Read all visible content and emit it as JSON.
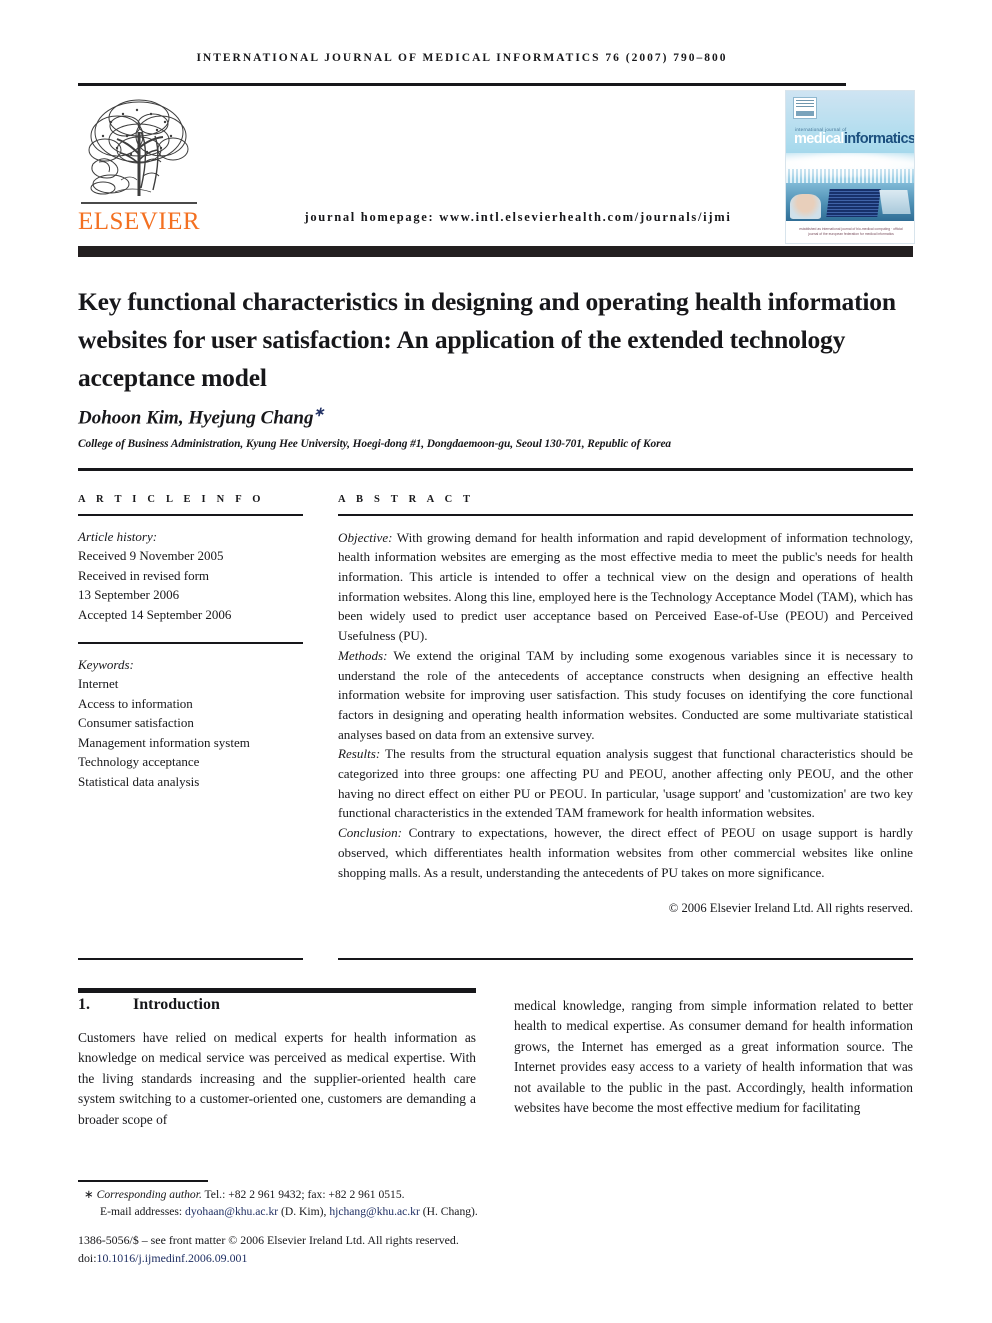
{
  "running_head": "International Journal of Medical Informatics 76 (2007) 790–800",
  "masthead": {
    "publisher_logo_text": "ELSEVIER",
    "homepage_line": "journal homepage: www.intl.elsevierhealth.com/journals/ijmi",
    "cover": {
      "kicker": "international journal of",
      "title_word1": "medical",
      "title_word2": "informatics",
      "footnote": "established as international journal of bio-medical computing  ·  official journal of the european federation for medical informatics"
    }
  },
  "article": {
    "title": "Key functional characteristics in designing and operating health information websites for user satisfaction: An application of the extended technology acceptance model",
    "authors": "Dohoon Kim, Hyejung Chang",
    "author_marker": "∗",
    "affiliation": "College of Business Administration, Kyung Hee University, Hoegi-dong #1, Dongdaemoon-gu, Seoul 130-701, Republic of Korea"
  },
  "info": {
    "label": "A R T I C L E  I N F O",
    "history_label": "Article history:",
    "history_lines": [
      "Received 9 November 2005",
      "Received in revised form",
      "13 September 2006",
      "Accepted 14 September 2006"
    ],
    "keywords_label": "Keywords:",
    "keywords": [
      "Internet",
      "Access to information",
      "Consumer satisfaction",
      "Management information system",
      "Technology acceptance",
      "Statistical data analysis"
    ]
  },
  "abstract": {
    "label": "A B S T R A C T",
    "sections": [
      {
        "lead": "Objective:",
        "text": " With growing demand for health information and rapid development of information technology, health information websites are emerging as the most effective media to meet the public's needs for health information. This article is intended to offer a technical view on the design and operations of health information websites. Along this line, employed here is the Technology Acceptance Model (TAM), which has been widely used to predict user acceptance based on Perceived Ease-of-Use (PEOU) and Perceived Usefulness (PU)."
      },
      {
        "lead": "Methods:",
        "text": " We extend the original TAM by including some exogenous variables since it is necessary to understand the role of the antecedents of acceptance constructs when designing an effective health information website for improving user satisfaction. This study focuses on identifying the core functional factors in designing and operating health information websites. Conducted are some multivariate statistical analyses based on data from an extensive survey."
      },
      {
        "lead": "Results:",
        "text": " The results from the structural equation analysis suggest that functional characteristics should be categorized into three groups: one affecting PU and PEOU, another affecting only PEOU, and the other having no direct effect on either PU or PEOU. In particular, 'usage support' and 'customization' are two key functional characteristics in the extended TAM framework for health information websites."
      },
      {
        "lead": "Conclusion:",
        "text": " Contrary to expectations, however, the direct effect of PEOU on usage support is hardly observed, which differentiates health information websites from other commercial websites like online shopping malls. As a result, understanding the antecedents of PU takes on more significance."
      }
    ],
    "copyright": "© 2006 Elsevier Ireland Ltd. All rights reserved."
  },
  "section": {
    "number": "1.",
    "heading": "Introduction",
    "col_left": "Customers have relied on medical experts for health information as knowledge on medical service was perceived as medical expertise. With the living standards increasing and the supplier-oriented health care system switching to a customer-oriented one, customers are demanding a broader scope of",
    "col_right": "medical knowledge, ranging from simple information related to better health to medical expertise. As consumer demand for health information grows, the Internet has emerged as a great information source. The Internet provides easy access to a variety of health information that was not available to the public in the past. Accordingly, health information websites have become the most effective medium for facilitating"
  },
  "footer": {
    "corresponding_marker": "∗",
    "corresponding_label": "Corresponding author.",
    "corresponding_tel": " Tel.: +82 2 961 9432; fax: +82 2 961 0515.",
    "email_label": "E-mail addresses:",
    "email1": "dyohaan@khu.ac.kr",
    "email1_name": " (D. Kim),",
    "email2": "hjchang@khu.ac.kr",
    "email2_name": " (H. Chang).",
    "issn_line": "1386-5056/$ – see front matter © 2006 Elsevier Ireland Ltd. All rights reserved.",
    "doi_prefix": "doi:",
    "doi": "10.1016/j.ijmedinf.2006.09.001"
  },
  "colors": {
    "elsevier_orange": "#f37021",
    "link_navy": "#1f2f63",
    "rule_black": "#17171a",
    "cover_blue": "#addcee",
    "cover_dark_blue": "#1b4f7e"
  }
}
